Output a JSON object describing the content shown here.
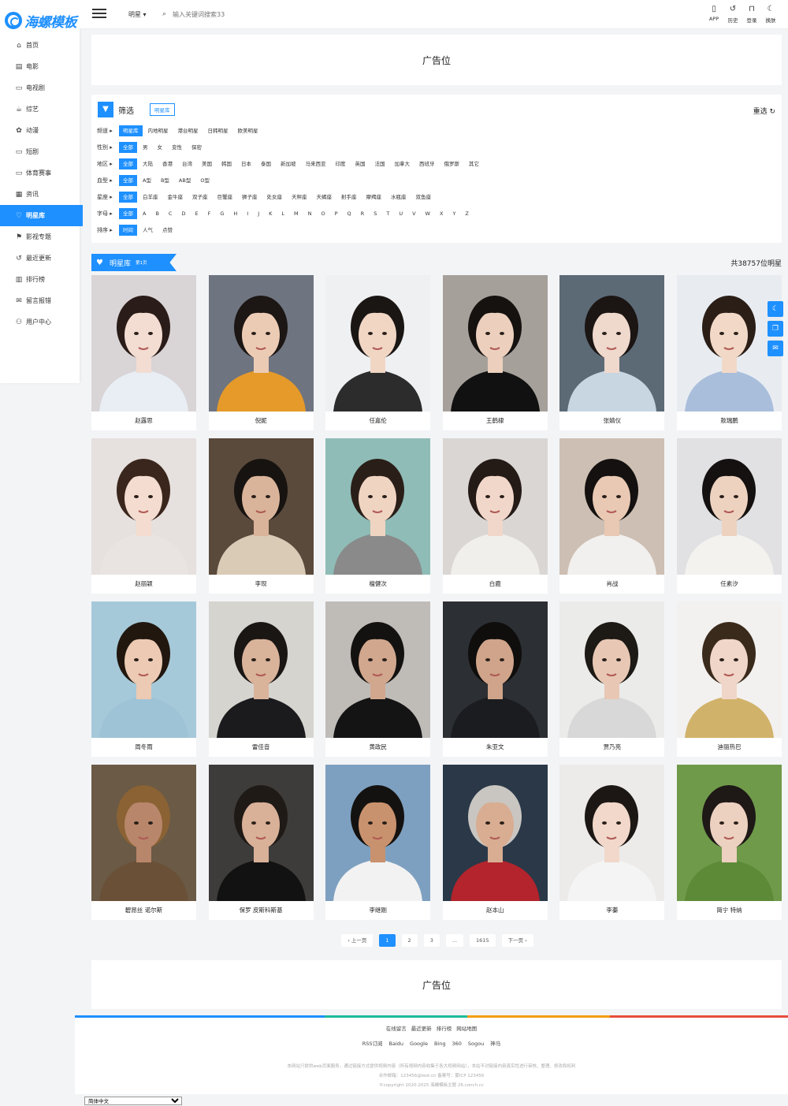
{
  "brand": {
    "logo_text": "海螺模板",
    "accent": "#1e90ff"
  },
  "sidebar": {
    "items": [
      {
        "label": "首页",
        "icon": "home-icon",
        "glyph": "⌂"
      },
      {
        "label": "电影",
        "icon": "film-icon",
        "glyph": "▤"
      },
      {
        "label": "电视剧",
        "icon": "tv-icon",
        "glyph": "▭"
      },
      {
        "label": "综艺",
        "icon": "coffee-icon",
        "glyph": "☕"
      },
      {
        "label": "动漫",
        "icon": "paw-icon",
        "glyph": "✿"
      },
      {
        "label": "短剧",
        "icon": "monitor-icon",
        "glyph": "▭"
      },
      {
        "label": "体育赛事",
        "icon": "monitor-icon",
        "glyph": "▭"
      },
      {
        "label": "资讯",
        "icon": "document-icon",
        "glyph": "▦"
      },
      {
        "label": "明星库",
        "icon": "heart-icon",
        "glyph": "♡",
        "active": true
      },
      {
        "label": "影视专题",
        "icon": "bookmark-icon",
        "glyph": "⚑"
      },
      {
        "label": "最近更新",
        "icon": "history-icon",
        "glyph": "↺"
      },
      {
        "label": "排行榜",
        "icon": "bar-chart-icon",
        "glyph": "▥"
      },
      {
        "label": "留言报错",
        "icon": "comment-icon",
        "glyph": "✉"
      },
      {
        "label": "用户中心",
        "icon": "user-icon",
        "glyph": "⚇"
      }
    ]
  },
  "header": {
    "category": "明星 ▾",
    "search_placeholder": "输入关键词搜索33",
    "actions": [
      {
        "label": "APP",
        "icon": "mobile-icon",
        "glyph": "▯"
      },
      {
        "label": "历史",
        "icon": "history-icon",
        "glyph": "↺"
      },
      {
        "label": "登录",
        "icon": "lock-icon",
        "glyph": "⊓"
      },
      {
        "label": "换肤",
        "icon": "moon-icon",
        "glyph": "☾"
      }
    ]
  },
  "ad_top": "广告位",
  "ad_bottom": "广告位",
  "filter": {
    "title": "筛选",
    "tag": "明星库",
    "reset": "重选 ↻",
    "rows": [
      {
        "label": "频道 ▸",
        "options": [
          "明星库",
          "内地明星",
          "港台明星",
          "日韩明星",
          "欧美明星"
        ],
        "active": 0
      },
      {
        "label": "性别 ▸",
        "options": [
          "全部",
          "男",
          "女",
          "变性",
          "保密"
        ],
        "active": 0
      },
      {
        "label": "地区 ▸",
        "options": [
          "全部",
          "大陆",
          "香港",
          "台湾",
          "美国",
          "韩国",
          "日本",
          "泰国",
          "新加坡",
          "马来西亚",
          "印度",
          "英国",
          "法国",
          "加拿大",
          "西班牙",
          "俄罗斯",
          "其它"
        ],
        "active": 0
      },
      {
        "label": "血型 ▸",
        "options": [
          "全部",
          "A型",
          "B型",
          "AB型",
          "O型"
        ],
        "active": 0
      },
      {
        "label": "星座 ▸",
        "options": [
          "全部",
          "白羊座",
          "金牛座",
          "双子座",
          "巨蟹座",
          "狮子座",
          "处女座",
          "天秤座",
          "天蝎座",
          "射手座",
          "摩羯座",
          "水瓶座",
          "双鱼座"
        ],
        "active": 0
      },
      {
        "label": "字母 ▸",
        "options": [
          "全部",
          "A",
          "B",
          "C",
          "D",
          "E",
          "F",
          "G",
          "H",
          "I",
          "J",
          "K",
          "L",
          "M",
          "N",
          "O",
          "P",
          "Q",
          "R",
          "S",
          "T",
          "U",
          "V",
          "W",
          "X",
          "Y",
          "Z"
        ],
        "active": 0
      },
      {
        "label": "排序 ▸",
        "options": [
          "时间",
          "人气",
          "点赞"
        ],
        "active": 0
      }
    ]
  },
  "section": {
    "title": "明星库",
    "sub": "第1页",
    "total": "共38757位明星"
  },
  "stars": [
    {
      "name": "赵露思",
      "bg": "#d9d4d6",
      "skin": "#f3dcd2",
      "hair": "#2a1c18",
      "cloth": "#e8eef4"
    },
    {
      "name": "倪妮",
      "bg": "#6e7480",
      "skin": "#eccbb5",
      "hair": "#1c1614",
      "cloth": "#e59a2a"
    },
    {
      "name": "任嘉伦",
      "bg": "#eef0f2",
      "skin": "#f1d6c4",
      "hair": "#1a1614",
      "cloth": "#2c2c2c"
    },
    {
      "name": "王鹤棣",
      "bg": "#a6a09a",
      "skin": "#ecd0bd",
      "hair": "#151210",
      "cloth": "#111111"
    },
    {
      "name": "张婧仪",
      "bg": "#5c6a76",
      "skin": "#efd8cc",
      "hair": "#1b1513",
      "cloth": "#c8d6e2"
    },
    {
      "name": "敖瑞鹏",
      "bg": "#e8ecf1",
      "skin": "#f2d9c7",
      "hair": "#2b1e17",
      "cloth": "#a9bedb"
    },
    {
      "name": "赵丽颖",
      "bg": "#e6e0de",
      "skin": "#f4dcd0",
      "hair": "#3a261c",
      "cloth": "#e9e4e2"
    },
    {
      "name": "李现",
      "bg": "#5a4a3c",
      "skin": "#d9b49a",
      "hair": "#171310",
      "cloth": "#d9cbb6"
    },
    {
      "name": "檀健次",
      "bg": "#8fbcb6",
      "skin": "#f0d4c2",
      "hair": "#2a1e18",
      "cloth": "#8a8a8a"
    },
    {
      "name": "白鹿",
      "bg": "#d9d6d4",
      "skin": "#f1d7c9",
      "hair": "#241a16",
      "cloth": "#f1efec"
    },
    {
      "name": "肖战",
      "bg": "#cdbfb3",
      "skin": "#e9c9b3",
      "hair": "#141110",
      "cloth": "#f2f0ee"
    },
    {
      "name": "任素汐",
      "bg": "#e1e1e3",
      "skin": "#eed2c0",
      "hair": "#141110",
      "cloth": "#f4f2ef"
    },
    {
      "name": "周冬雨",
      "bg": "#a6c9d9",
      "skin": "#eccab4",
      "hair": "#21170f",
      "cloth": "#9ec3d6"
    },
    {
      "name": "雷佳音",
      "bg": "#d6d4cf",
      "skin": "#d9b39a",
      "hair": "#1a1614",
      "cloth": "#1b1b1e"
    },
    {
      "name": "黄政民",
      "bg": "#bfbcb8",
      "skin": "#d1a78e",
      "hair": "#141210",
      "cloth": "#141414"
    },
    {
      "name": "朱亚文",
      "bg": "#2c2f33",
      "skin": "#cfa48a",
      "hair": "#0f0e0d",
      "cloth": "#1a1c1f"
    },
    {
      "name": "贾乃亮",
      "bg": "#ebebea",
      "skin": "#e8c8b4",
      "hair": "#1d1915",
      "cloth": "#d8d8d8"
    },
    {
      "name": "迪丽热巴",
      "bg": "#f3f1ef",
      "skin": "#f0d6c8",
      "hair": "#3a2a1c",
      "cloth": "#d1b26a"
    },
    {
      "name": "碧昂丝 诺尔斯",
      "bg": "#6a5a46",
      "skin": "#b8866a",
      "hair": "#8a6234",
      "cloth": "#6b5038"
    },
    {
      "name": "保罗 皮斯科斯基",
      "bg": "#3d3c3a",
      "skin": "#d9b098",
      "hair": "#1f1a16",
      "cloth": "#121212"
    },
    {
      "name": "李继刚",
      "bg": "#7ea0c0",
      "skin": "#c9926e",
      "hair": "#141210",
      "cloth": "#f2f2f2"
    },
    {
      "name": "赵本山",
      "bg": "#2a3848",
      "skin": "#d8ad92",
      "hair": "#c9c6c2",
      "cloth": "#b3242c"
    },
    {
      "name": "李蓁",
      "bg": "#ecebea",
      "skin": "#f1d8ca",
      "hair": "#1c1714",
      "cloth": "#f4f4f4"
    },
    {
      "name": "简宁 特纳",
      "bg": "#6f9a4a",
      "skin": "#ecd0c0",
      "hair": "#1e1816",
      "cloth": "#5d8a36"
    }
  ],
  "pager": {
    "prev": "‹ 上一页",
    "pages": [
      "1",
      "2",
      "3",
      "...",
      "1615"
    ],
    "active": 0,
    "next": "下一页 ›"
  },
  "float_tools": [
    {
      "icon": "moon-icon",
      "glyph": "☾"
    },
    {
      "icon": "copy-icon",
      "glyph": "❐"
    },
    {
      "icon": "comment-icon",
      "glyph": "✉"
    }
  ],
  "footer": {
    "links": [
      "在线留言",
      "最近更新",
      "排行榜",
      "网站地图"
    ],
    "rss": [
      "RSS订阅",
      "Baidu",
      "Google",
      "Bing",
      "360",
      "Sogou",
      "神马"
    ],
    "disclaimer": "本网站只提供web页面服务，通过链接方式提供视频内容（所有视频内容收集于各大视频网站），本站不对链接内容真实性进行审核、整理、修改和权利",
    "contact": "合作邮箱：123456@test.cn 备案号：蒙ICP 123456",
    "copyright": "©copyright 2020-2025 海螺模板主题 26.conch.cc"
  },
  "language": "简体中文"
}
